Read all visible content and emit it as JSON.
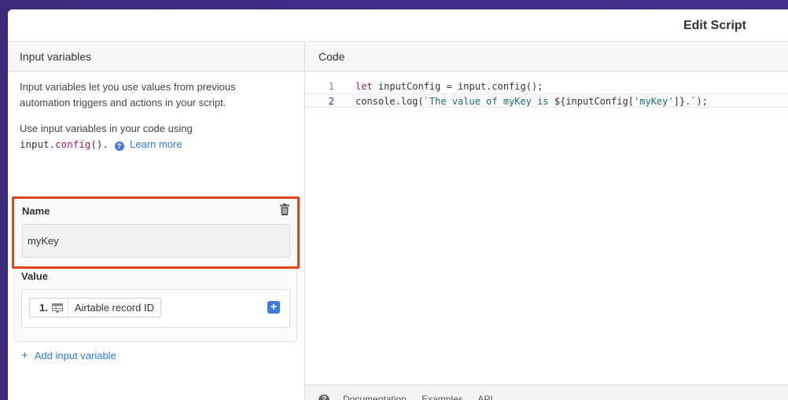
{
  "modal": {
    "title": "Edit Script"
  },
  "left_panel": {
    "heading": "Input variables",
    "description": "Input variables let you use values from previous automation triggers and actions in your script.",
    "usage_prefix": "Use input variables in your code using",
    "usage_code_obj": "input.",
    "usage_code_fn": "config",
    "usage_code_suffix": "().",
    "learn_more": "Learn more",
    "variable": {
      "name_label": "Name",
      "name_value": "myKey",
      "value_label": "Value",
      "token_number": "1.",
      "token_label": "Airtable record ID"
    },
    "add_variable": "Add input variable"
  },
  "code_panel": {
    "heading": "Code",
    "lines": [
      {
        "number": "1",
        "kw": "let",
        "rest": " inputConfig = input.config();"
      },
      {
        "number": "2",
        "pre": "console.log(",
        "tpl_a": "`The value of myKey is ",
        "tpl_expr": "${inputConfig[",
        "str": "'myKey'",
        "tpl_expr_end": "]}",
        "tpl_b": ".`",
        "post": ");"
      }
    ],
    "bottom_links": [
      "Documentation",
      "Examples",
      "API"
    ]
  },
  "colors": {
    "accent": "#2d7be0",
    "highlight_border": "#e0461c",
    "backdrop": "#3a2a7a"
  },
  "icons": [
    "help-circle-icon",
    "trash-icon",
    "table-icon",
    "plus-square-icon",
    "plus-icon",
    "question-icon"
  ]
}
